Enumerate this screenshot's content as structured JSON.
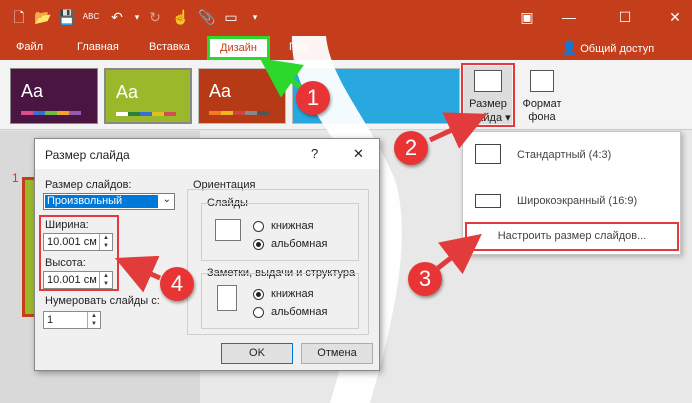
{
  "ribbon_tabs": {
    "file": "Файл",
    "home": "Главная",
    "insert": "Вставка",
    "design": "Дизайн",
    "transitions_partial": "Пер",
    "share": "Общий доступ"
  },
  "ribbon": {
    "slide_size_line1": "Размер",
    "slide_size_line2": "слайда",
    "format_bg_line1": "Формат",
    "format_bg_line2": "фона",
    "theme_glyph": "Aa"
  },
  "slide_number": "1",
  "dialog": {
    "title": "Размер слайда",
    "help": "?",
    "close": "✕",
    "size_label": "Размер слайдов:",
    "size_value": "Произвольный",
    "width_label": "Ширина:",
    "width_value": "10.001 см",
    "height_label": "Высота:",
    "height_value": "10.001 см",
    "number_from_label": "Нумеровать слайды с:",
    "number_from_value": "1",
    "orientation_label": "Ориентация",
    "slides_label": "Слайды",
    "slides_portrait": "книжная",
    "slides_landscape": "альбомная",
    "notes_label": "Заметки, выдачи и структура",
    "notes_portrait": "книжная",
    "notes_landscape": "альбомная",
    "ok": "OK",
    "cancel": "Отмена"
  },
  "dropdown_menu": {
    "standard": "Стандартный (4:3)",
    "widescreen": "Широкоэкранный (16:9)",
    "custom": "Настроить размер слайдов..."
  },
  "badges": [
    "1",
    "2",
    "3",
    "4"
  ],
  "colors": {
    "title_bar": "#c43e1c",
    "highlight_green": "#2dd82d",
    "annotation_red": "#e23b3b",
    "selection_blue": "#0078d7"
  }
}
